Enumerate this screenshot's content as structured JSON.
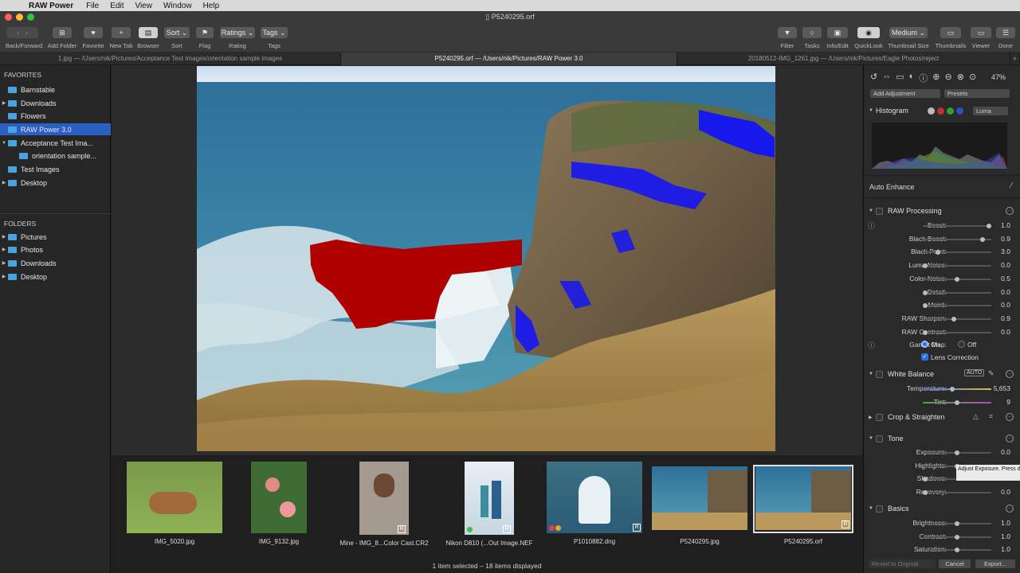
{
  "menubar": {
    "app": "RAW Power",
    "items": [
      "File",
      "Edit",
      "View",
      "Window",
      "Help"
    ]
  },
  "window": {
    "title": "P5240295.orf"
  },
  "toolbar": {
    "labels": {
      "back_forward": "Back/Forward",
      "add_folder": "Add Folder",
      "favorite": "Favorite",
      "new_tab": "New Tab",
      "browser": "Browser",
      "sort": "Sort",
      "flag": "Flag",
      "rating": "Rating",
      "tags": "Tags",
      "filter": "Filter",
      "tasks": "Tasks",
      "info_edit": "Info/Edit",
      "quicklook": "QuickLook",
      "thumbnail_size": "Thumbnail Size",
      "thumbnails": "Thumbnails",
      "viewer": "Viewer",
      "done": "Done"
    },
    "sort_btn": "Sort",
    "ratings_btn": "Ratings",
    "tags_btn": "Tags",
    "size_btn": "Medium"
  },
  "tabs": [
    "1.jpg  —  /Users/nik/Pictures/Acceptance Test Images/orientation sample images",
    "P5240295.orf  —  /Users/nik/Pictures/RAW Power 3.0",
    "20180512-IMG_1261.jpg  —  /Users/nik/Pictures/Eagle Photos/reject"
  ],
  "sidebar": {
    "favorites_header": "FAVORITES",
    "favorites": [
      "Barnstable",
      "Downloads",
      "Flowers",
      "RAW Power 3.0",
      "Acceptance Test Ima...",
      "orientation sample...",
      "Test Images",
      "Desktop"
    ],
    "folders_header": "FOLDERS",
    "folders": [
      "Pictures",
      "Photos",
      "Downloads",
      "Desktop"
    ]
  },
  "thumbnails": [
    "IMG_5020.jpg",
    "IMG_9132.jpg",
    "Mine - IMG_8...Color Cast.CR2",
    "Nikon D810 (...Out Image.NEF",
    "P1010882.dng",
    "P5240295.jpg",
    "P5240295.orf"
  ],
  "status": "1 item selected – 18 items displayed",
  "panel": {
    "zoom": "47%",
    "add_adjustment": "Add Adjustment",
    "presets": "Presets",
    "histogram": "Histogram",
    "luma": "Luma",
    "auto_enhance": "Auto Enhance",
    "raw_processing": "RAW Processing",
    "raw_sliders": [
      {
        "label": "Boost:",
        "value": "1.0",
        "pos": 1.0
      },
      {
        "label": "Black Boost:",
        "value": "0.9",
        "pos": 0.9
      },
      {
        "label": "Black Point:",
        "value": "3.0",
        "pos": 0.2
      },
      {
        "label": "Luma Noise:",
        "value": "0.0",
        "pos": 0.0
      },
      {
        "label": "Color Noise:",
        "value": "0.5",
        "pos": 0.5
      },
      {
        "label": "Detail:",
        "value": "0.0",
        "pos": 0.0
      },
      {
        "label": "Moiré:",
        "value": "0.0",
        "pos": 0.0
      },
      {
        "label": "RAW Sharpen:",
        "value": "0.9",
        "pos": 0.45
      },
      {
        "label": "RAW Contrast:",
        "value": "0.0",
        "pos": 0.0
      }
    ],
    "gamut_map": "Gamut Map:",
    "on": "On",
    "off": "Off",
    "lens_correction": "Lens Correction",
    "white_balance": "White Balance",
    "auto": "AUTO",
    "wb_sliders": [
      {
        "label": "Temperature:",
        "value": "5,653",
        "pos": 0.42
      },
      {
        "label": "Tint:",
        "value": "9",
        "pos": 0.5
      }
    ],
    "crop": "Crop & Straighten",
    "tone": "Tone",
    "tone_sliders": [
      {
        "label": "Exposure:",
        "value": "0.0",
        "pos": 0.5
      },
      {
        "label": "Highlights:",
        "value": "",
        "pos": 0.5
      },
      {
        "label": "Shadows:",
        "value": "",
        "pos": 0.0
      },
      {
        "label": "Recovery:",
        "value": "0.0",
        "pos": 0.0
      }
    ],
    "basics": "Basics",
    "basic_sliders": [
      {
        "label": "Brightness:",
        "value": "1.0",
        "pos": 0.5
      },
      {
        "label": "Contrast:",
        "value": "1.0",
        "pos": 0.5
      },
      {
        "label": "Saturation:",
        "value": "1.0",
        "pos": 0.5
      }
    ],
    "revert": "Revert to Original",
    "cancel": "Cancel",
    "export": "Export..."
  },
  "tooltip": "Adjust Exposure. Press dragging to see a hot",
  "colors": {
    "selection": "#2a5fc4",
    "clip_red": "#b00000",
    "clip_blue": "#1010ff"
  }
}
